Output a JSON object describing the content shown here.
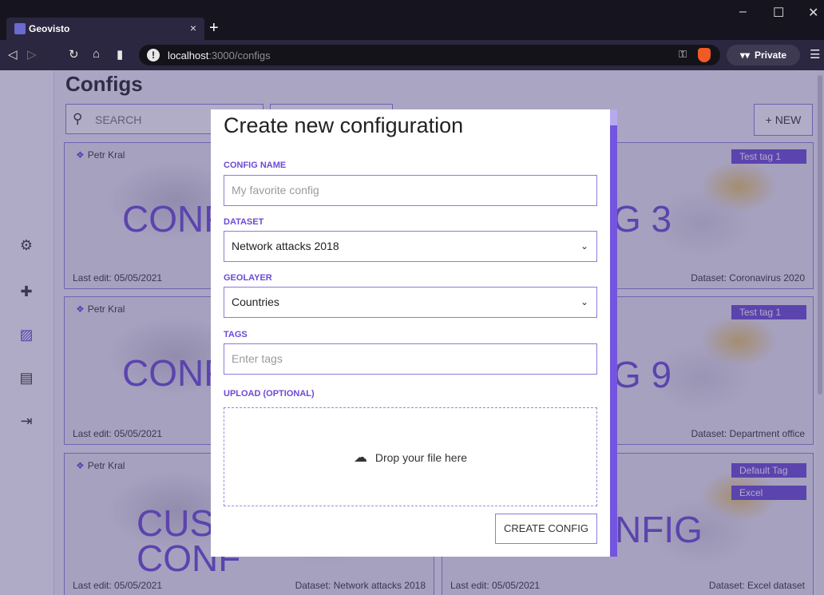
{
  "browser": {
    "tab_title": "Geovisto",
    "tab_close": "×",
    "new_tab": "+",
    "url_host": "localhost",
    "url_path": ":3000/configs",
    "private_label": "Private",
    "window": {
      "minimize": "–",
      "maximize": "☐",
      "close": "✕"
    }
  },
  "page": {
    "title": "Configs",
    "search_placeholder": "SEARCH",
    "new_button": "+ NEW"
  },
  "cards": [
    {
      "author": "Petr Kral",
      "name": "CONF",
      "tag": "",
      "last_edit": "Last edit: 05/05/2021",
      "dataset": ""
    },
    {
      "author": "",
      "name": "G 3",
      "tag": "Test tag 1",
      "last_edit": "",
      "dataset": "Dataset: Coronavirus 2020"
    },
    {
      "author": "Petr Kral",
      "name": "CONF",
      "tag": "",
      "last_edit": "Last edit: 05/05/2021",
      "dataset": ""
    },
    {
      "author": "",
      "name": "G 9",
      "tag": "Test tag 1",
      "last_edit": "",
      "dataset": "Dataset: Department office"
    },
    {
      "author": "Petr Kral",
      "name_line1": "CUST",
      "name_line2": "CONF",
      "last_edit": "Last edit: 05/05/2021",
      "dataset": "Dataset: Network attacks 2018"
    },
    {
      "author": "",
      "name": "NFIG",
      "tags": [
        "Default Tag",
        "Excel"
      ],
      "last_edit": "Last edit: 05/05/2021",
      "dataset": "Dataset: Excel dataset"
    }
  ],
  "modal": {
    "title": "Create new configuration",
    "config_name_label": "CONFIG NAME",
    "config_name_placeholder": "My favorite config",
    "dataset_label": "DATASET",
    "dataset_value": "Network attacks 2018",
    "geolayer_label": "GEOLAYER",
    "geolayer_value": "Countries",
    "tags_label": "TAGS",
    "tags_placeholder": "Enter tags",
    "upload_label": "UPLOAD (OPTIONAL)",
    "drop_text": "Drop your file here",
    "create_button": "CREATE CONFIG"
  },
  "colors": {
    "accent": "#6c4ad6",
    "overlay": "#463c78"
  }
}
